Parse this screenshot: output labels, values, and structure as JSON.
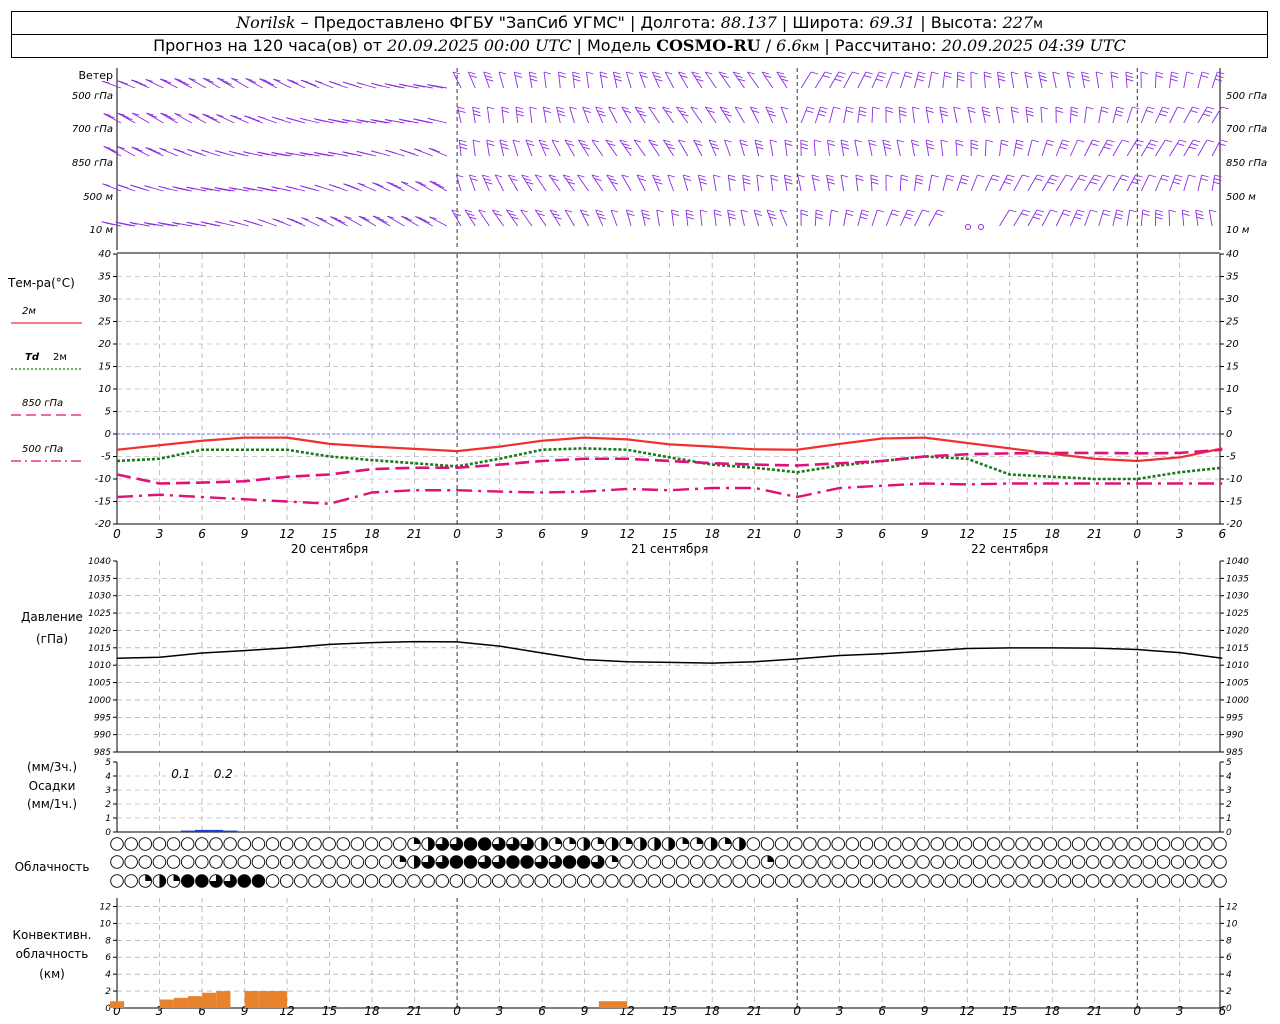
{
  "header": {
    "station": "Norilsk",
    "dash": " – ",
    "provider": "Предоставлено ФГБУ \"ЗапСиб УГМС\"",
    "sep": " | ",
    "lon_label": "Долгота: ",
    "lon": "88.137",
    "lat_label": "Широта: ",
    "lat": "69.31",
    "alt_label": "Высота: ",
    "alt": "227",
    "alt_unit": "м",
    "forecast_label": "Прогноз на 120 часа(ов) от ",
    "forecast_from": "20.09.2025 00:00 UTC",
    "model_label": "Модель ",
    "model": "COSMO-RU",
    "model_res": "6.6",
    "model_res_unit": "км",
    "computed_label": "Рассчитано: ",
    "computed": "20.09.2025 04:39 UTC"
  },
  "chart_data": {
    "type": "meteogram",
    "time_axis": {
      "unit": "UTC hours",
      "range": [
        0,
        54
      ],
      "tick_step": 3,
      "tick_labels": [
        "0",
        "3",
        "6",
        "9",
        "12",
        "15",
        "18",
        "21",
        "0",
        "3",
        "6",
        "9",
        "12",
        "15",
        "18",
        "21",
        "0",
        "3",
        "6",
        "9",
        "12",
        "15",
        "18",
        "21",
        "0",
        "3",
        "6"
      ],
      "day_labels": [
        {
          "hour": 15,
          "label": "20 сентября"
        },
        {
          "hour": 39,
          "label": "21 сентября"
        },
        {
          "hour": 63,
          "label": "22 сентября"
        }
      ],
      "midnights": [
        24,
        48,
        72
      ]
    },
    "wind_panel": {
      "title": "Ветер",
      "levels": [
        "500 гПа",
        "700 гПа",
        "850 гПа",
        "500 м",
        "10 м"
      ],
      "barb_color": "#8a2be2",
      "barb_step_hours": 1
    },
    "temperature_panel": {
      "title": "Тем-ра(°C)",
      "ylim": [
        -20,
        40
      ],
      "yticks": [
        -20,
        -15,
        -10,
        -5,
        0,
        5,
        10,
        15,
        20,
        25,
        30,
        35,
        40
      ],
      "series": [
        {
          "name": "2м",
          "legend_prefix": "",
          "color": "#ee3030",
          "style": "solid",
          "x": [
            0,
            3,
            6,
            9,
            12,
            15,
            18,
            21,
            24,
            27,
            30,
            33,
            36,
            39,
            42,
            45,
            48,
            51,
            54,
            57,
            60,
            63,
            66,
            69,
            72,
            75,
            78
          ],
          "values": [
            -3.5,
            -2.5,
            -1.5,
            -0.8,
            -0.8,
            -2.2,
            -2.8,
            -3.3,
            -3.8,
            -2.8,
            -1.5,
            -0.8,
            -1.2,
            -2.3,
            -2.8,
            -3.4,
            -3.5,
            -2.2,
            -1.0,
            -0.8,
            -2.0,
            -3.2,
            -4.4,
            -5.5,
            -6.0,
            -5.2,
            -3.2
          ]
        },
        {
          "name": "2м",
          "legend_prefix": "Td",
          "color": "#1a7a1a",
          "style": "dotted",
          "x": [
            0,
            3,
            6,
            9,
            12,
            15,
            18,
            21,
            24,
            27,
            30,
            33,
            36,
            39,
            42,
            45,
            48,
            51,
            54,
            57,
            60,
            63,
            66,
            69,
            72,
            75,
            78
          ],
          "values": [
            -6.0,
            -5.5,
            -3.5,
            -3.5,
            -3.5,
            -5.0,
            -5.8,
            -6.5,
            -7.2,
            -5.5,
            -3.5,
            -3.2,
            -3.5,
            -5.2,
            -6.8,
            -7.5,
            -8.5,
            -7.0,
            -6.0,
            -5.0,
            -5.5,
            -9.0,
            -9.5,
            -10.0,
            -10.0,
            -8.5,
            -7.5
          ]
        },
        {
          "name": "850 гПа",
          "legend_prefix": "",
          "color": "#e0107a",
          "style": "dashed",
          "x": [
            0,
            3,
            6,
            9,
            12,
            15,
            18,
            21,
            24,
            27,
            30,
            33,
            36,
            39,
            42,
            45,
            48,
            51,
            54,
            57,
            60,
            63,
            66,
            69,
            72,
            75,
            78
          ],
          "values": [
            -9.0,
            -11.0,
            -10.8,
            -10.5,
            -9.5,
            -9.0,
            -7.8,
            -7.5,
            -7.5,
            -6.8,
            -6.0,
            -5.5,
            -5.5,
            -6.0,
            -6.5,
            -6.8,
            -7.0,
            -6.5,
            -6.0,
            -5.0,
            -4.5,
            -4.3,
            -4.2,
            -4.2,
            -4.3,
            -4.2,
            -3.5
          ]
        },
        {
          "name": "500 гПа",
          "legend_prefix": "",
          "color": "#e0107a",
          "style": "dashdot",
          "x": [
            0,
            3,
            6,
            9,
            12,
            15,
            18,
            21,
            24,
            27,
            30,
            33,
            36,
            39,
            42,
            45,
            48,
            51,
            54,
            57,
            60,
            63,
            66,
            69,
            72,
            75,
            78
          ],
          "values": [
            -14.0,
            -13.5,
            -14.0,
            -14.5,
            -15.0,
            -15.5,
            -13.0,
            -12.5,
            -12.5,
            -12.8,
            -13.0,
            -12.8,
            -12.2,
            -12.5,
            -12.0,
            -12.0,
            -14.0,
            -12.0,
            -11.5,
            -11.0,
            -11.2,
            -11.0,
            -11.0,
            -11.0,
            -11.0,
            -11.0,
            -11.0
          ]
        }
      ]
    },
    "pressure_panel": {
      "title": "Давление",
      "unit": "(гПа)",
      "ylim": [
        985,
        1040
      ],
      "yticks": [
        985,
        990,
        995,
        1000,
        1005,
        1010,
        1015,
        1020,
        1025,
        1030,
        1035,
        1040
      ],
      "color": "#000000",
      "x": [
        0,
        3,
        6,
        9,
        12,
        15,
        18,
        21,
        24,
        27,
        30,
        33,
        36,
        39,
        42,
        45,
        48,
        51,
        54,
        57,
        60,
        63,
        66,
        69,
        72,
        75,
        78
      ],
      "values": [
        1012.0,
        1012.3,
        1013.5,
        1014.2,
        1015.0,
        1016.0,
        1016.5,
        1016.8,
        1016.7,
        1015.5,
        1013.5,
        1011.6,
        1011.0,
        1010.8,
        1010.6,
        1011.0,
        1011.8,
        1012.8,
        1013.3,
        1014.0,
        1014.8,
        1015.0,
        1015.0,
        1014.9,
        1014.5,
        1013.6,
        1012.0
      ]
    },
    "precipitation_panel": {
      "title": "Осадки",
      "unit_3h": "(мм/3ч.)",
      "unit_1h": "(мм/1ч.)",
      "ylim": [
        0,
        5
      ],
      "yticks": [
        0,
        1,
        2,
        3,
        4,
        5
      ],
      "bar_color": "#1a3ad6",
      "totals_3h": [
        {
          "hour": 4.5,
          "label": "0.1"
        },
        {
          "hour": 7.5,
          "label": "0.2"
        }
      ],
      "bars_1h": [
        {
          "hour": 5,
          "value": 0.1
        },
        {
          "hour": 6,
          "value": 0.15
        },
        {
          "hour": 7,
          "value": 0.15
        },
        {
          "hour": 8,
          "value": 0.1
        }
      ]
    },
    "cloud_panel": {
      "title": "Облачность",
      "rows": 3,
      "columns": 79,
      "row_high_filled": {
        "21": 0.25,
        "22": 0.5,
        "23": 0.75,
        "24": 0.75,
        "25": 1.0,
        "26": 1.0,
        "27": 0.75,
        "28": 0.75,
        "29": 0.75,
        "30": 0.5,
        "31": 0.25,
        "32": 0.25,
        "33": 0.5,
        "34": 0.25,
        "35": 0.5,
        "36": 0.25,
        "37": 0.5,
        "38": 0.5,
        "39": 0.5,
        "40": 0.25,
        "41": 0.25,
        "42": 0.5,
        "43": 0.25,
        "44": 0.5
      },
      "row_mid_filled": {
        "20": 0.25,
        "21": 0.5,
        "22": 0.75,
        "23": 0.75,
        "24": 1.0,
        "25": 1.0,
        "26": 0.75,
        "27": 0.75,
        "28": 1.0,
        "29": 1.0,
        "30": 0.75,
        "31": 0.75,
        "32": 1.0,
        "33": 1.0,
        "34": 0.75,
        "35": 0.25,
        "46": 0.25
      },
      "row_low_filled": {
        "2": 0.25,
        "3": 0.5,
        "4": 0.25,
        "5": 1.0,
        "6": 1.0,
        "7": 0.75,
        "8": 0.75,
        "9": 1.0,
        "10": 1.0
      }
    },
    "convective_panel": {
      "title_line1": "Конвективн.",
      "title_line2": "облачность",
      "unit": "(км)",
      "ylim": [
        0,
        13
      ],
      "yticks": [
        0,
        2,
        4,
        6,
        8,
        10,
        12
      ],
      "bar_color": "#e8822c",
      "bars": [
        {
          "hour": 0,
          "top": 0.8
        },
        {
          "hour": 3.5,
          "top": 1.0
        },
        {
          "hour": 4.5,
          "top": 1.2
        },
        {
          "hour": 5.5,
          "top": 1.4
        },
        {
          "hour": 6.5,
          "top": 1.8
        },
        {
          "hour": 7.5,
          "top": 2.0
        },
        {
          "hour": 9.5,
          "top": 2.0
        },
        {
          "hour": 10.5,
          "top": 2.0
        },
        {
          "hour": 11.5,
          "top": 2.0
        },
        {
          "hour": 34.5,
          "top": 0.8
        },
        {
          "hour": 35.5,
          "top": 0.8
        }
      ]
    }
  }
}
